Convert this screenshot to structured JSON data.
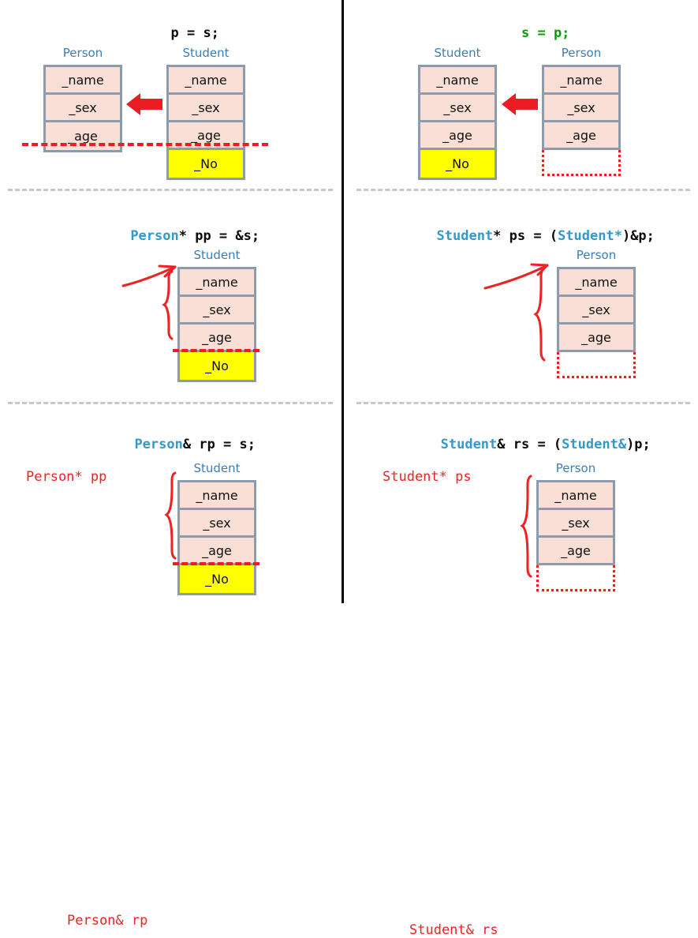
{
  "meta": {
    "colors": {
      "type_blue": "#3399cc",
      "label_blue": "#3a7fb5",
      "annotation_red": "#ee2222",
      "slice_red": "#ec1c24",
      "green": "#0a9b0a",
      "box_border": "#8c9bad",
      "box_fill": "#fadfd6",
      "highlight_yellow": "#ffff00",
      "divider_grey": "#c8c8c8",
      "divider_black": "#000000"
    },
    "member_names": [
      "_name",
      "_sex",
      "_age",
      "_No"
    ]
  },
  "panels": [
    {
      "id": "p-equals-s",
      "title_tokens": [
        {
          "text": "p = s;",
          "color": "dark"
        }
      ],
      "objects": [
        {
          "id": "person-left",
          "label": "Person",
          "rows": [
            {
              "text": "_name",
              "style": "normal"
            },
            {
              "text": "_sex",
              "style": "normal"
            },
            {
              "text": "_age",
              "style": "normal"
            }
          ]
        },
        {
          "id": "student-right",
          "label": "Student",
          "rows": [
            {
              "text": "_name",
              "style": "normal"
            },
            {
              "text": "_sex",
              "style": "normal"
            },
            {
              "text": "_age",
              "style": "normal"
            },
            {
              "text": "_No",
              "style": "yellow"
            }
          ]
        }
      ],
      "arrow": {
        "direction": "left",
        "name": "slicing-copy-arrow"
      },
      "slice_line": true,
      "annotations": []
    },
    {
      "id": "s-equals-p",
      "title_tokens": [
        {
          "text": "s = p;",
          "color": "green"
        }
      ],
      "objects": [
        {
          "id": "student-left",
          "label": "Student",
          "rows": [
            {
              "text": "_name",
              "style": "normal"
            },
            {
              "text": "_sex",
              "style": "normal"
            },
            {
              "text": "_age",
              "style": "normal"
            },
            {
              "text": "_No",
              "style": "yellow"
            }
          ]
        },
        {
          "id": "person-right",
          "label": "Person",
          "rows": [
            {
              "text": "_name",
              "style": "normal"
            },
            {
              "text": "_sex",
              "style": "normal"
            },
            {
              "text": "_age",
              "style": "normal"
            },
            {
              "text": "",
              "style": "dotted-empty"
            }
          ]
        }
      ],
      "arrow": {
        "direction": "left",
        "name": "illegal-copy-arrow"
      },
      "slice_line": false,
      "annotations": []
    },
    {
      "id": "person-ptr-pp",
      "title_tokens": [
        {
          "text": "Person",
          "color": "type"
        },
        {
          "text": "* pp = &s;",
          "color": "dark"
        }
      ],
      "objects": [
        {
          "id": "student-ptr",
          "label": "Student",
          "rows": [
            {
              "text": "_name",
              "style": "normal"
            },
            {
              "text": "_sex",
              "style": "normal"
            },
            {
              "text": "_age",
              "style": "normal"
            },
            {
              "text": "_No",
              "style": "yellow"
            }
          ]
        }
      ],
      "arrow": null,
      "slice_line": true,
      "annotations": [
        {
          "text": "Person* pp",
          "name": "annotation-person-ptr-pp"
        }
      ]
    },
    {
      "id": "student-ptr-ps",
      "title_tokens": [
        {
          "text": "Student",
          "color": "type"
        },
        {
          "text": "* ps = (",
          "color": "dark"
        },
        {
          "text": "Student*",
          "color": "type"
        },
        {
          "text": ")&p;",
          "color": "dark"
        }
      ],
      "objects": [
        {
          "id": "person-ptr",
          "label": "Person",
          "rows": [
            {
              "text": "_name",
              "style": "normal"
            },
            {
              "text": "_sex",
              "style": "normal"
            },
            {
              "text": "_age",
              "style": "normal"
            },
            {
              "text": "",
              "style": "dotted-empty"
            }
          ]
        }
      ],
      "arrow": null,
      "slice_line": false,
      "annotations": [
        {
          "text": "Student* ps",
          "name": "annotation-student-ptr-ps"
        }
      ]
    },
    {
      "id": "person-ref-rp",
      "title_tokens": [
        {
          "text": "Person",
          "color": "type"
        },
        {
          "text": "& rp = s;",
          "color": "dark"
        }
      ],
      "objects": [
        {
          "id": "student-ref",
          "label": "Student",
          "rows": [
            {
              "text": "_name",
              "style": "normal"
            },
            {
              "text": "_sex",
              "style": "normal"
            },
            {
              "text": "_age",
              "style": "normal"
            },
            {
              "text": "_No",
              "style": "yellow"
            }
          ]
        }
      ],
      "arrow": null,
      "slice_line": true,
      "annotations": [
        {
          "text": "Person& rp",
          "name": "annotation-person-ref-rp"
        }
      ]
    },
    {
      "id": "student-ref-rs",
      "title_tokens": [
        {
          "text": "Student",
          "color": "type"
        },
        {
          "text": "& rs = (",
          "color": "dark"
        },
        {
          "text": "Student&",
          "color": "type"
        },
        {
          "text": ")p;",
          "color": "dark"
        }
      ],
      "objects": [
        {
          "id": "person-ref",
          "label": "Person",
          "rows": [
            {
              "text": "_name",
              "style": "normal"
            },
            {
              "text": "_sex",
              "style": "normal"
            },
            {
              "text": "_age",
              "style": "normal"
            },
            {
              "text": "",
              "style": "dotted-empty"
            }
          ]
        }
      ],
      "arrow": null,
      "slice_line": false,
      "annotations": [
        {
          "text": "Student& rs",
          "name": "annotation-student-ref-rs"
        }
      ]
    }
  ]
}
